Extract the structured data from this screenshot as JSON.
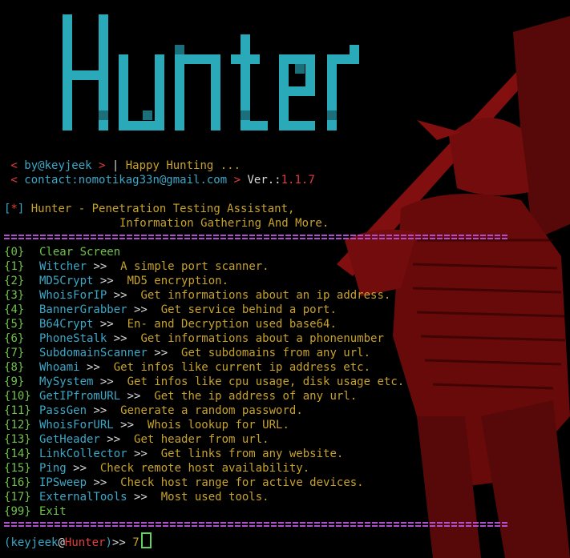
{
  "terminal": {
    "banner_title": "Hunter",
    "byline": {
      "author": "by@keyjeek",
      "tagline": "Happy Hunting ..."
    },
    "contact": {
      "label": "contact:nomotikag33n@gmail.com",
      "version_label": "Ver.:",
      "version": "1.1.7"
    },
    "info_marker": "*",
    "info_line_1": "Hunter - Penetration Testing Assistant,",
    "info_line_2": "Information Gathering And More.",
    "menu": [
      {
        "num": "0",
        "tool": "Clear Screen",
        "desc": ""
      },
      {
        "num": "1",
        "tool": "Witcher",
        "desc": "A simple port scanner."
      },
      {
        "num": "2",
        "tool": "MD5Crypt",
        "desc": "MD5 encryption."
      },
      {
        "num": "3",
        "tool": "WhoisForIP",
        "desc": "Get informations about an ip address."
      },
      {
        "num": "4",
        "tool": "BannerGrabber",
        "desc": "Get service behind a port."
      },
      {
        "num": "5",
        "tool": "B64Crypt",
        "desc": "En- and Decryption used base64."
      },
      {
        "num": "6",
        "tool": "PhoneStalk",
        "desc": "Get informations about a phonenumber"
      },
      {
        "num": "7",
        "tool": "SubdomainScanner",
        "desc": "Get subdomains from any url."
      },
      {
        "num": "8",
        "tool": "Whoami",
        "desc": "Get infos like current ip address etc."
      },
      {
        "num": "9",
        "tool": "MySystem",
        "desc": "Get infos like cpu usage, disk usage etc."
      },
      {
        "num": "10",
        "tool": "GetIPfromURL",
        "desc": "Get the ip address of any url."
      },
      {
        "num": "11",
        "tool": "PassGen",
        "desc": "Generate a random password."
      },
      {
        "num": "12",
        "tool": "WhoisForURL",
        "desc": "Whois lookup for URL."
      },
      {
        "num": "13",
        "tool": "GetHeader",
        "desc": "Get header from url."
      },
      {
        "num": "14",
        "tool": "LinkCollector",
        "desc": "Get links from any website."
      },
      {
        "num": "15",
        "tool": "Ping",
        "desc": "Check remote host availability."
      },
      {
        "num": "16",
        "tool": "IPSweep",
        "desc": "Check host range for active devices."
      },
      {
        "num": "17",
        "tool": "ExternalTools",
        "desc": "Most used tools."
      },
      {
        "num": "99",
        "tool": "Exit",
        "desc": ""
      }
    ],
    "prompt": {
      "user": "keyjeek",
      "host": "Hunter",
      "suffix": ">>",
      "input_value": "7"
    }
  },
  "colors": {
    "background": "#000000",
    "banner": "#2aa9b9",
    "green": "#6fc24a",
    "cyan": "#3aa8c8",
    "yellow": "#c7a227",
    "red": "#e23c3c",
    "separator": "#b04fcf",
    "samurai": "#7a0d0d"
  },
  "icons": {
    "background_art": "samurai-illustration"
  }
}
